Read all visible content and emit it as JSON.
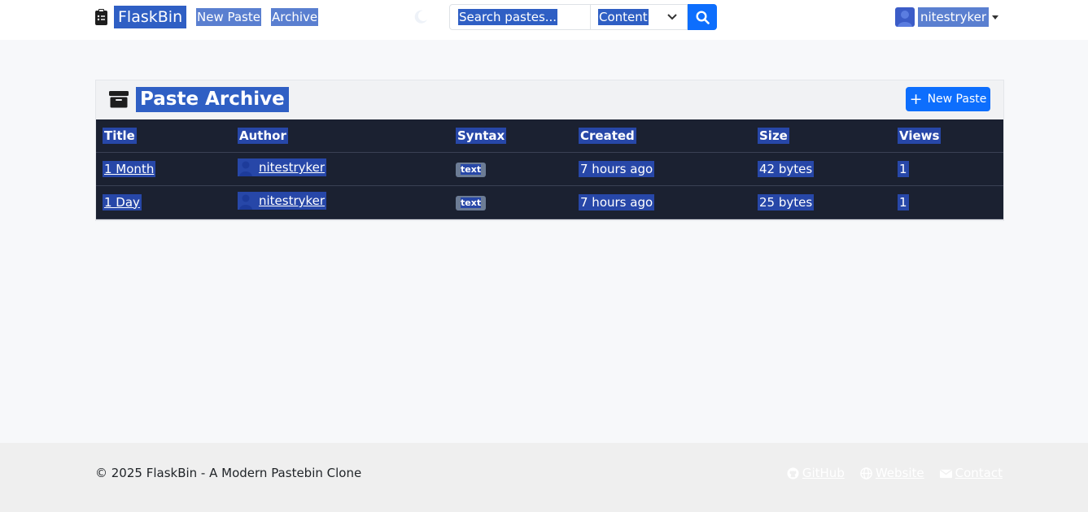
{
  "navbar": {
    "brand": "FlaskBin",
    "links": {
      "new_paste": "New Paste",
      "archive": "Archive"
    },
    "search": {
      "placeholder": "Search pastes...",
      "scope": "Content"
    },
    "user": {
      "name": "nitestryker"
    }
  },
  "archive": {
    "title": "Paste Archive",
    "new_button": "New Paste",
    "columns": [
      "Title",
      "Author",
      "Syntax",
      "Created",
      "Size",
      "Views"
    ],
    "rows": [
      {
        "title": "1 Month",
        "author": "nitestryker",
        "syntax": "text",
        "created": "7 hours ago",
        "size": "42 bytes",
        "views": "1"
      },
      {
        "title": "1 Day",
        "author": "nitestryker",
        "syntax": "text",
        "created": "7 hours ago",
        "size": "25 bytes",
        "views": "1"
      }
    ]
  },
  "footer": {
    "copyright": "© 2025 FlaskBin - A Modern Pastebin Clone",
    "links": [
      "GitHub",
      "Website",
      "Contact"
    ]
  },
  "colors": {
    "accent": "#0d6efd",
    "table_bg": "#1b2131",
    "selection": "#2f5fc4"
  }
}
